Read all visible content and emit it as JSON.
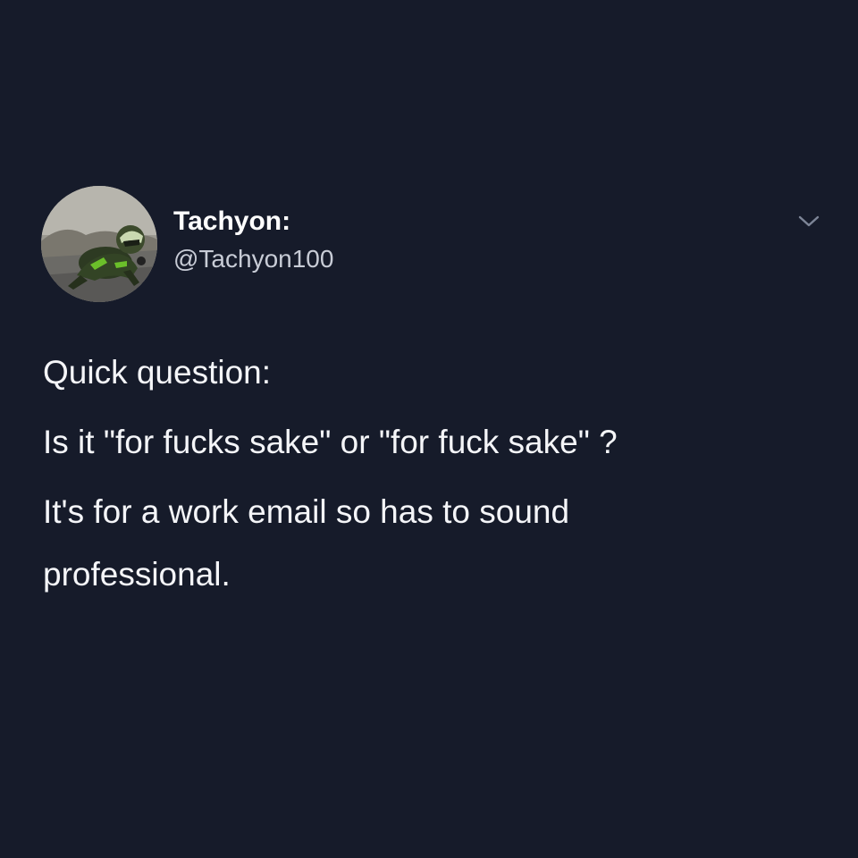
{
  "tweet": {
    "author": {
      "display_name": "Tachyon:",
      "handle": "@Tachyon100",
      "avatar_icon": "avatar-photo-motorcyclist"
    },
    "menu_icon": "chevron-down-icon",
    "text_lines": [
      "Quick question:",
      "Is it \"for fucks sake\" or \"for fuck sake\" ?",
      "It's for a work email so has to sound",
      "professional."
    ]
  },
  "colors": {
    "background": "#161b2a",
    "text": "#f4f5f8",
    "handle": "#c8ccd6",
    "chevron": "#7d8597"
  }
}
